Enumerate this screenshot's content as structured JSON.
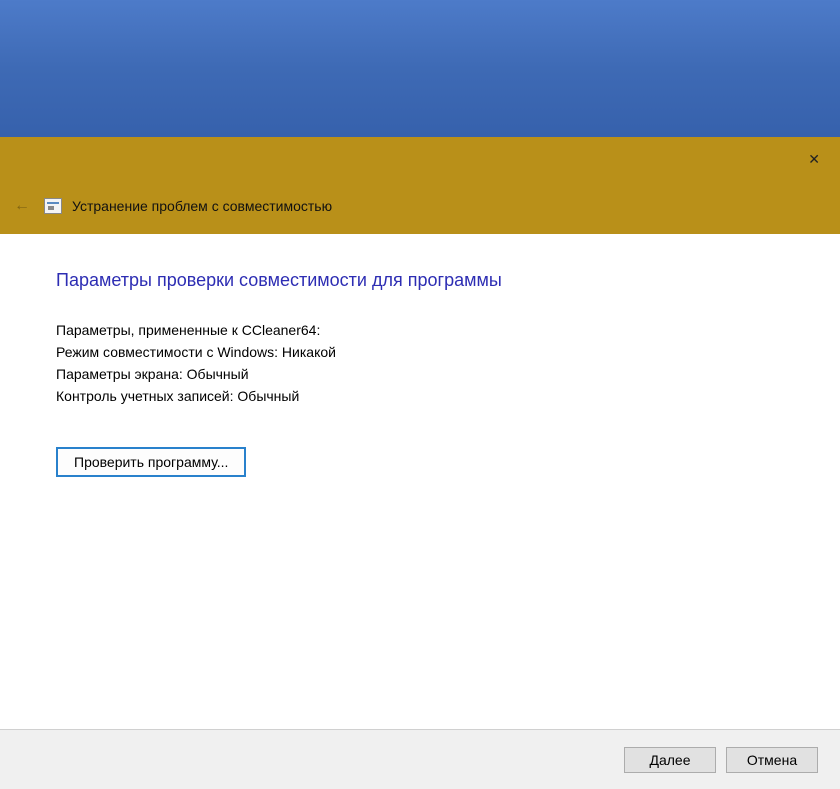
{
  "header": {
    "title": "Устранение проблем с совместимостью"
  },
  "content": {
    "heading": "Параметры проверки совместимости для программы",
    "params_applied_to": "Параметры, примененные к  CCleaner64:",
    "compat_mode": "Режим совместимости с Windows: Никакой",
    "screen_params": "Параметры экрана:  Обычный",
    "uac": "Контроль учетных записей:  Обычный",
    "verify_button": "Проверить программу..."
  },
  "footer": {
    "next": "Далее",
    "cancel": "Отмена"
  }
}
